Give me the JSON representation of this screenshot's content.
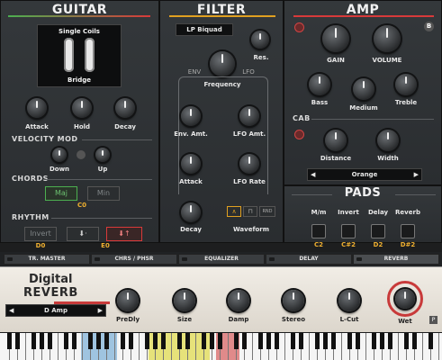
{
  "colors": {
    "guitar_accent": "#4caf50",
    "filter_accent": "#e0a020",
    "amp_accent": "#d83a3a",
    "note_gold": "#f0b030",
    "reverb_red": "#c83a3a"
  },
  "guitar": {
    "title": "GUITAR",
    "pickup_type": "Single Coils",
    "pickup_position": "Bridge",
    "knobs": [
      "Attack",
      "Hold",
      "Decay"
    ],
    "velocity_mod": {
      "title": "VELOCITY MOD",
      "down": "Down",
      "up": "Up"
    },
    "chords": {
      "title": "CHORDS",
      "maj": "Maj",
      "min": "Min",
      "note": "C0"
    },
    "rhythm": {
      "title": "RHYTHM",
      "invert": "Invert",
      "notes": [
        "D0",
        "E0"
      ]
    }
  },
  "filter": {
    "title": "FILTER",
    "type": "LP Biquad",
    "res": "Res.",
    "env": "ENV",
    "lfo": "LFO",
    "frequency": "Frequency",
    "env_amt": "Env. Amt.",
    "lfo_amt": "LFO Amt.",
    "attack": "Attack",
    "lfo_rate": "LFO Rate",
    "decay": "Decay",
    "waveform": "Waveform",
    "rnd": "RND"
  },
  "amp": {
    "title": "AMP",
    "badge": "B",
    "gain": "GAIN",
    "volume": "VOLUME",
    "bass": "Bass",
    "medium": "Medium",
    "treble": "Treble",
    "cab_title": "CAB",
    "distance": "Distance",
    "width": "Width",
    "cab_model": "Orange"
  },
  "pads": {
    "title": "PADS",
    "labels": [
      "M/m",
      "Invert",
      "Delay",
      "Reverb"
    ],
    "notes": [
      "C2",
      "C#2",
      "D2",
      "D#2"
    ]
  },
  "tabs": [
    "TR. MASTER",
    "CHRS / PHSR",
    "EQUALIZER",
    "DELAY",
    "REVERB"
  ],
  "reverb": {
    "name_line1": "Digital",
    "name_line2": "REVERB",
    "preset": "D Amp",
    "knobs": [
      "PreDly",
      "Size",
      "Damp",
      "Stereo",
      "L-Cut",
      "Wet"
    ],
    "footer_badge": "P"
  },
  "keyboard": {
    "highlight_zones": [
      "blue",
      "yellow",
      "red"
    ]
  }
}
